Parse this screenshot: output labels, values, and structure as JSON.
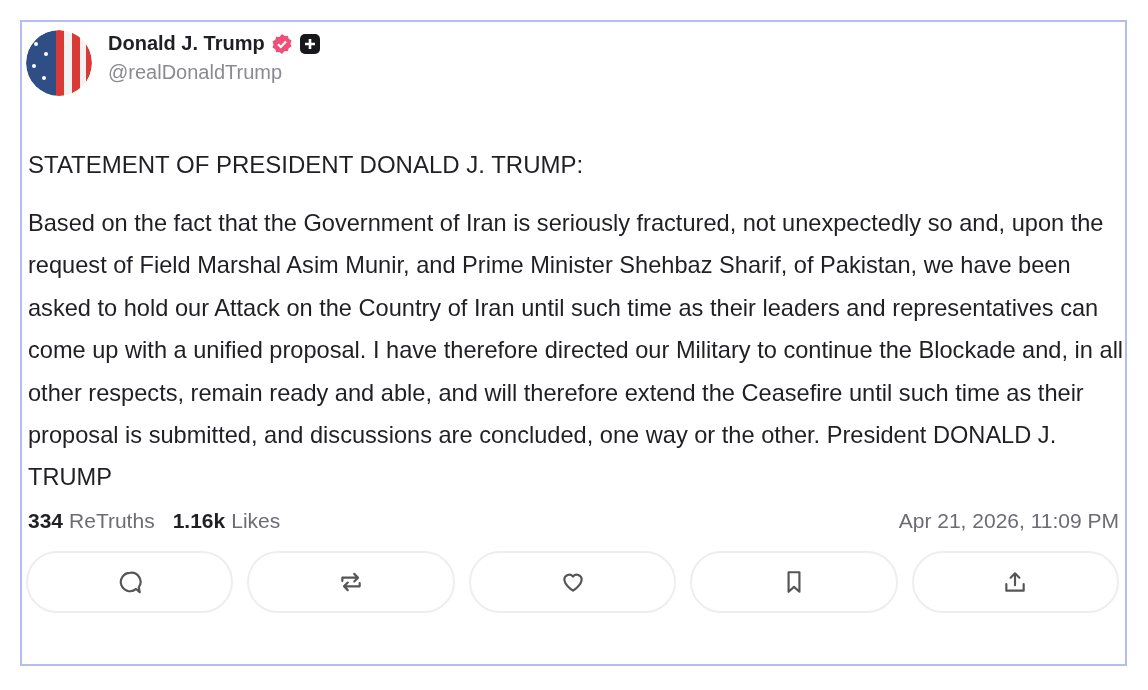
{
  "post": {
    "author": {
      "name": "Donald J. Trump",
      "handle": "@realDonaldTrump"
    },
    "title": "STATEMENT OF PRESIDENT DONALD J. TRUMP:",
    "body": "Based on the fact that the Government of Iran is seriously fractured, not unexpectedly so and, upon the request of Field Marshal Asim Munir, and Prime Minister Shehbaz Sharif, of Pakistan, we have been asked to hold our Attack on the Country of Iran until such time as their leaders and representatives can come up with a unified proposal. I have therefore directed our Military to continue the Blockade and, in all other respects, remain ready and able, and will therefore extend the Ceasefire until such time as their proposal is submitted, and discussions are concluded, one way or the other. President DONALD J. TRUMP",
    "stats": [
      {
        "count": "334",
        "label": "ReTruths"
      },
      {
        "count": "1.16k",
        "label": "Likes"
      }
    ],
    "timestamp": "Apr 21, 2026, 11:09 PM",
    "actions": [
      {
        "kind": "reply"
      },
      {
        "kind": "retruth"
      },
      {
        "kind": "like"
      },
      {
        "kind": "bookmark"
      },
      {
        "kind": "share"
      }
    ]
  }
}
